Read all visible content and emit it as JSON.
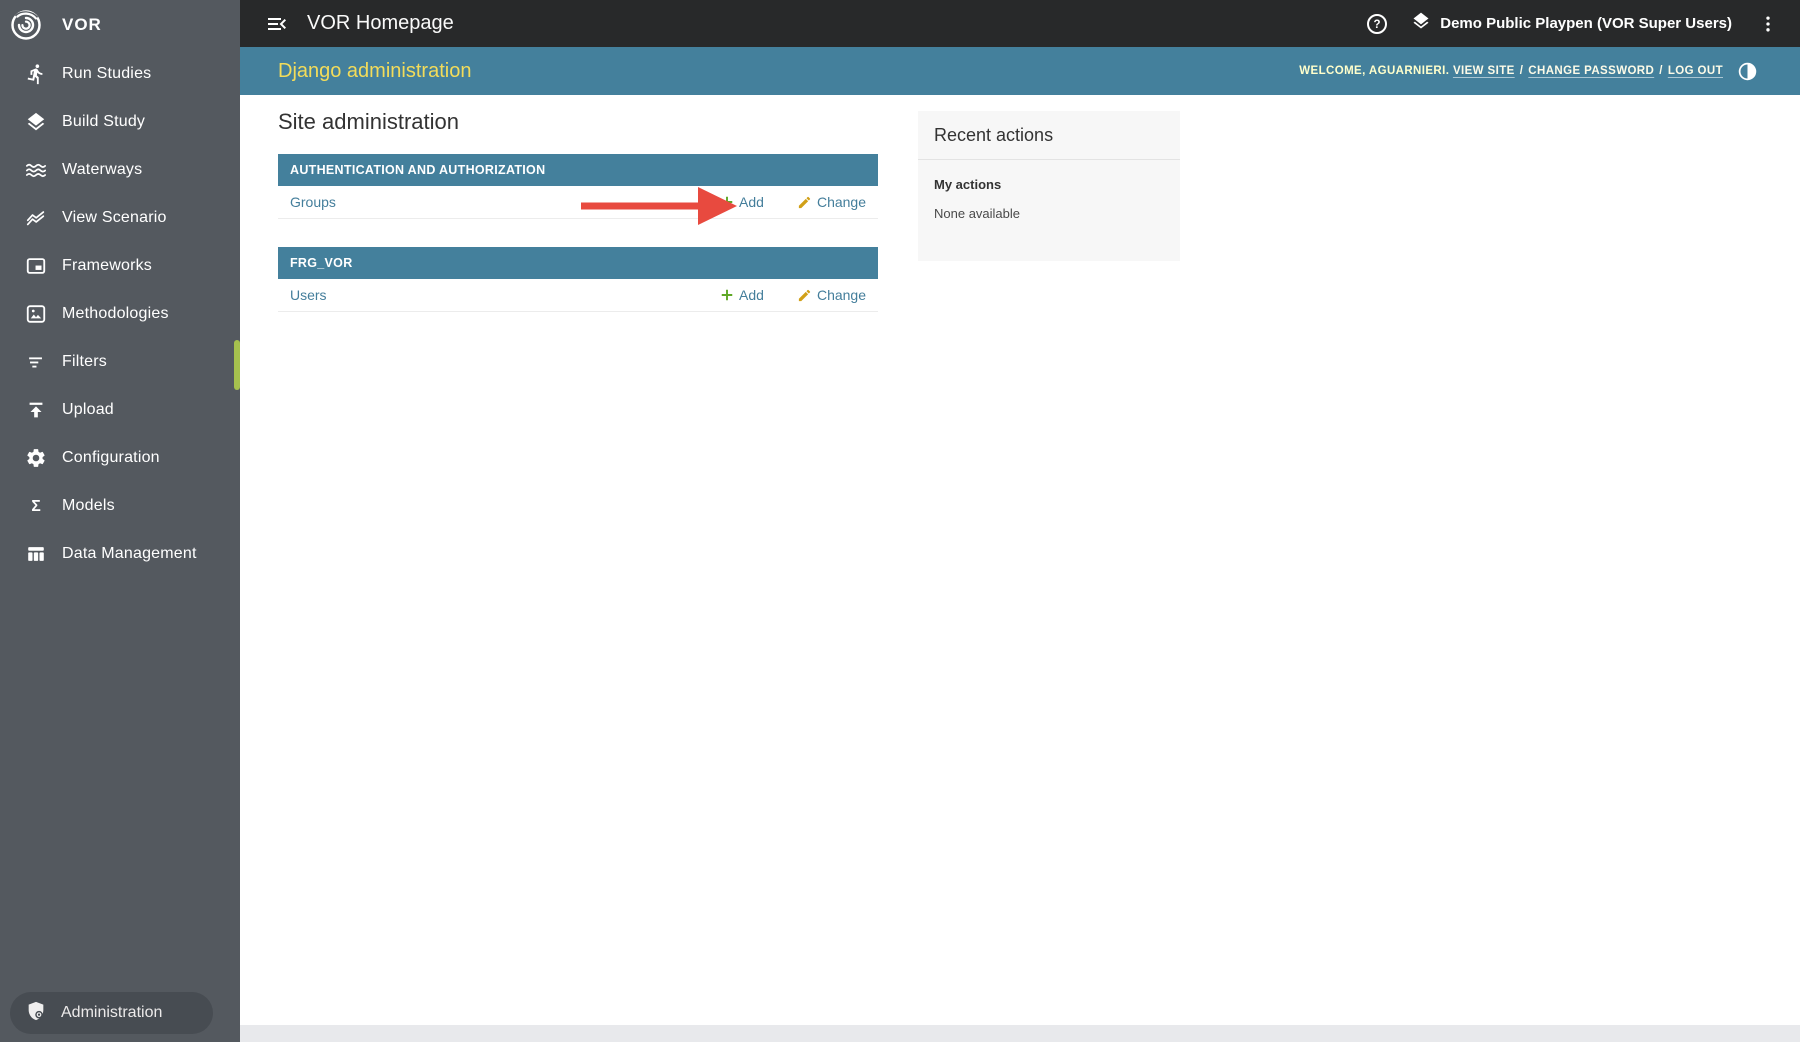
{
  "colors": {
    "sidebar_bg": "#54595f",
    "sidebar_pill_bg": "#474c52",
    "topbar_bg": "#28292a",
    "teal": "#44809c",
    "brand_yellow": "#f3dc5a",
    "welcome_yellow": "#ffffcc",
    "link_teal": "#447e9b",
    "add_green": "#5fa826",
    "change_gold": "#d1a018",
    "arrow_red": "#e84a3f",
    "scroll_thumb_lime": "#a6c14e",
    "recent_bg": "#f7f7f7",
    "bottom_strip": "#e8e9ec"
  },
  "sidebar": {
    "brand": "VOR",
    "items": [
      {
        "label": "Run Studies",
        "icon": "run-icon"
      },
      {
        "label": "Build Study",
        "icon": "layers-icon"
      },
      {
        "label": "Waterways",
        "icon": "waves-icon"
      },
      {
        "label": "View Scenario",
        "icon": "trend-lines-icon"
      },
      {
        "label": "Frameworks",
        "icon": "picture-in-picture-icon"
      },
      {
        "label": "Methodologies",
        "icon": "image-icon"
      },
      {
        "label": "Filters",
        "icon": "filter-icon"
      },
      {
        "label": "Upload",
        "icon": "upload-icon"
      },
      {
        "label": "Configuration",
        "icon": "gear-icon"
      },
      {
        "label": "Models",
        "icon": "sigma-icon"
      },
      {
        "label": "Data Management",
        "icon": "table-columns-icon"
      }
    ],
    "admin": {
      "label": "Administration"
    }
  },
  "topbar": {
    "title": "VOR Homepage",
    "context": "Demo Public Playpen (VOR Super Users)"
  },
  "django": {
    "title": "Django administration",
    "welcome": "WELCOME, AGUARNIERI.",
    "sep": "/",
    "links": [
      {
        "label": "VIEW SITE"
      },
      {
        "label": "CHANGE PASSWORD"
      },
      {
        "label": "LOG OUT"
      }
    ]
  },
  "main": {
    "heading": "Site administration",
    "modules": [
      {
        "caption": "AUTHENTICATION AND AUTHORIZATION",
        "rows": [
          {
            "name": "Groups",
            "add": "Add",
            "change": "Change"
          }
        ]
      },
      {
        "caption": "FRG_VOR",
        "rows": [
          {
            "name": "Users",
            "add": "Add",
            "change": "Change"
          }
        ]
      }
    ],
    "recent": {
      "title": "Recent actions",
      "subtitle": "My actions",
      "empty": "None available"
    }
  }
}
